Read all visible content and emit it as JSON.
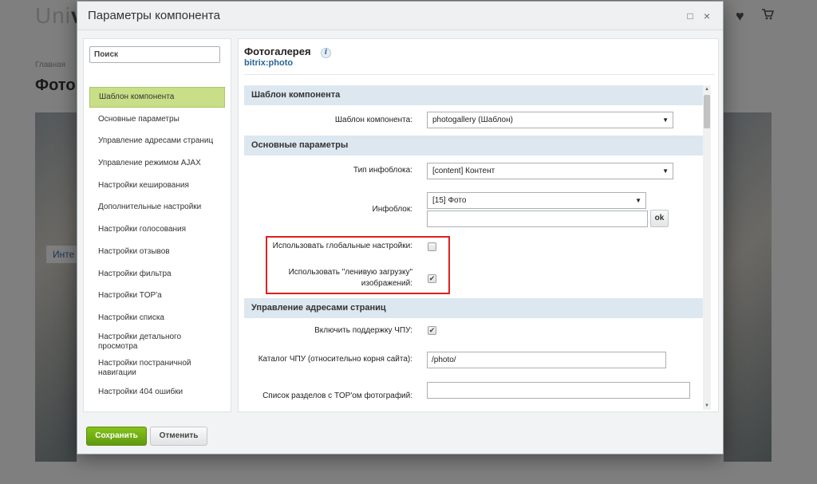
{
  "background": {
    "logo_prefix": "Uni",
    "logo_bold": "v",
    "breadcrumb": "Главная",
    "page_title": "Фотог",
    "tag": "Инте"
  },
  "dialog": {
    "title": "Параметры компонента",
    "maximize_icon": "□",
    "close_icon": "×"
  },
  "sidebar": {
    "search_placeholder": "Поиск",
    "items": [
      {
        "label": "Шаблон компонента",
        "active": true
      },
      {
        "label": "Основные параметры"
      },
      {
        "label": "Управление адресами страниц"
      },
      {
        "label": "Управление режимом AJAX"
      },
      {
        "label": "Настройки кеширования"
      },
      {
        "label": "Дополнительные настройки"
      },
      {
        "label": "Настройки голосования"
      },
      {
        "label": "Настройки отзывов"
      },
      {
        "label": "Настройки фильтра"
      },
      {
        "label": "Настройки TOP'а"
      },
      {
        "label": "Настройки списка"
      },
      {
        "label": "Настройки детального просмотра"
      },
      {
        "label": "Настройки постраничной навигации"
      },
      {
        "label": "Настройки 404 ошибки"
      }
    ]
  },
  "component": {
    "name": "Фотогалерея",
    "code": "bitrix:photo",
    "info_icon": "i"
  },
  "sections": {
    "template": "Шаблон компонента",
    "basic": "Основные параметры",
    "urls": "Управление адресами страниц"
  },
  "fields": {
    "template_label": "Шаблон компонента:",
    "template_value": "photogallery (Шаблон)",
    "iblock_type_label": "Тип инфоблока:",
    "iblock_type_value": "[content] Контент",
    "iblock_label": "Инфоблок:",
    "iblock_value": "[15] Фото",
    "iblock_extra_value": "",
    "ok_label": "ok",
    "global_settings_label": "Использовать глобальные настройки:",
    "global_settings_checked": false,
    "lazy_load_label_line1": "Использовать \"ленивую загрузку\"",
    "lazy_load_label_line2": "изображений:",
    "lazy_load_checked": true,
    "sef_label": "Включить поддержку ЧПУ:",
    "sef_checked": true,
    "sef_folder_label": "Каталог ЧПУ (относительно корня сайта):",
    "sef_folder_value": "/photo/",
    "top_sections_label": "Список разделов с TOP'ом фотографий:",
    "top_sections_value": ""
  },
  "footer": {
    "save_label": "Сохранить",
    "cancel_label": "Отменить"
  },
  "colors": {
    "active_nav": "#c8df87",
    "section_bg": "#dce7ef",
    "save_button": "#6fab14",
    "highlight_border": "#e02020",
    "link": "#2a6496"
  }
}
